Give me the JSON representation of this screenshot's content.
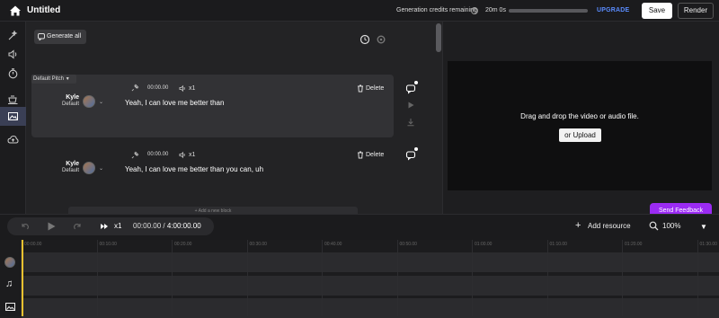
{
  "header": {
    "title": "Untitled",
    "credits_label": "Generation credits remaining",
    "help": "?",
    "credits_time": "20m 0s",
    "credits_fraction": 1.0,
    "upgrade": "UPGRADE",
    "save": "Save",
    "render": "Render"
  },
  "left_rail": {
    "items": [
      "magic-icon",
      "volume-icon",
      "timer-icon",
      "coffee-icon",
      "image-icon",
      "cloud-upload-icon"
    ],
    "active_index": 4
  },
  "editor": {
    "generate_all": "Generate all",
    "pitch_label": "Default Pitch",
    "blocks": [
      {
        "speaker": "Kyle",
        "voice_style": "Default",
        "timestamp": "00:00.00",
        "speed": "x1",
        "delete": "Delete",
        "text": "Yeah, I can love me better than"
      },
      {
        "speaker": "Kyle",
        "voice_style": "Default",
        "timestamp": "00:00.00",
        "speed": "x1",
        "delete": "Delete",
        "text": "Yeah, I can love me better than you can, uh"
      }
    ],
    "add_block": "+ Add a new block"
  },
  "preview": {
    "drop_text": "Drag and drop the video or audio file.",
    "upload": "or Upload",
    "feedback": "Send Feedback"
  },
  "transport": {
    "speed": "x1",
    "current_time": "00:00.00",
    "separator": "/",
    "total_time": "4:00:00.00",
    "add_resource": "Add resource",
    "zoom": "100%"
  },
  "timeline": {
    "ticks": [
      "00:00.00",
      "00:10.00",
      "00:20.00",
      "00:30.00",
      "00:40.00",
      "00:50.00",
      "01:00.00",
      "01:10.00",
      "01:20.00",
      "01:30.00"
    ]
  },
  "colors": {
    "accent_blue": "#5a8cff",
    "feedback_purple": "#9b2bf3",
    "playhead": "#f2c230"
  }
}
